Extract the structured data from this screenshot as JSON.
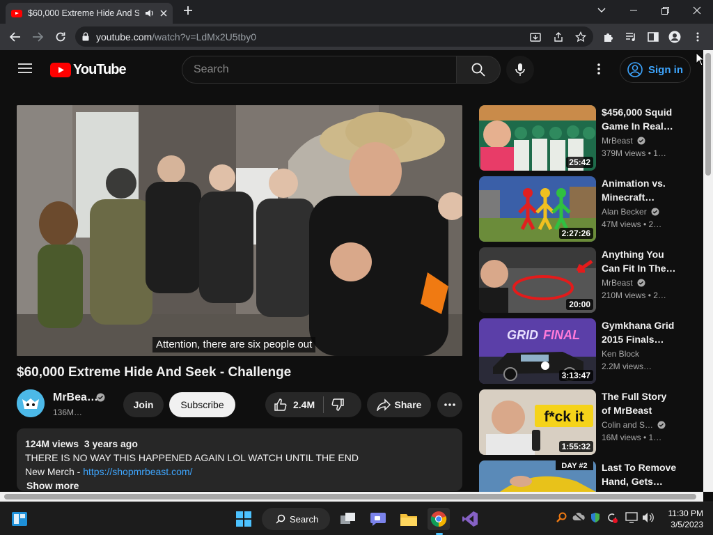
{
  "browser": {
    "tab_title": "$60,000 Extreme Hide And S",
    "url_host": "youtube.com",
    "url_path": "/watch?v=LdMx2U5tby0"
  },
  "header": {
    "logo_text": "YouTube",
    "search_placeholder": "Search",
    "signin_label": "Sign in"
  },
  "video": {
    "caption": "Attention, there are six people out",
    "title": "$60,000 Extreme Hide And Seek - Challenge",
    "channel": "MrBea…",
    "subscribers": "136M…",
    "join_label": "Join",
    "subscribe_label": "Subscribe",
    "likes": "2.4M",
    "share_label": "Share"
  },
  "description": {
    "views": "124M views",
    "age": "3 years ago",
    "line1": "THERE IS NO WAY THIS HAPPENED AGAIN LOL WATCH UNTIL THE END",
    "merch_label": "New Merch - ",
    "merch_link": "https://shopmrbeast.com/",
    "show_more": "Show more"
  },
  "recommendations": [
    {
      "title_line1": "$456,000 Squid",
      "title_line2": "Game In Real…",
      "channel": "MrBeast",
      "views": "379M views  • 1…",
      "duration": "25:42",
      "verified": true
    },
    {
      "title_line1": "Animation vs.",
      "title_line2": "Minecraft…",
      "channel": "Alan Becker",
      "views": "47M views  • 2…",
      "duration": "2:27:26",
      "verified": true
    },
    {
      "title_line1": "Anything You",
      "title_line2": "Can Fit In The…",
      "channel": "MrBeast",
      "views": "210M views  • 2…",
      "duration": "20:00",
      "verified": true
    },
    {
      "title_line1": "Gymkhana Grid",
      "title_line2": "2015 Finals…",
      "channel": "Ken Block",
      "views": "2.2M views…",
      "duration": "3:13:47",
      "verified": false
    },
    {
      "title_line1": "The Full Story",
      "title_line2": "of MrBeast",
      "channel": "Colin and S…",
      "views": "16M views  • 1…",
      "duration": "1:55:32",
      "verified": true
    },
    {
      "title_line1": "Last To Remove",
      "title_line2": "Hand, Gets…",
      "channel": "",
      "views": "",
      "duration": "",
      "verified": false
    }
  ],
  "thumb_text": {
    "rec5": "f*ck it",
    "rec6": "DAY #2",
    "rec4a": "GRID",
    "rec4b": "FINAL"
  },
  "taskbar": {
    "search_label": "Search",
    "time": "11:30 PM",
    "date": "3/5/2023"
  },
  "colors": {
    "youtube_red": "#ff0000",
    "link_blue": "#3ea6ff",
    "background": "#0f0f0f"
  }
}
